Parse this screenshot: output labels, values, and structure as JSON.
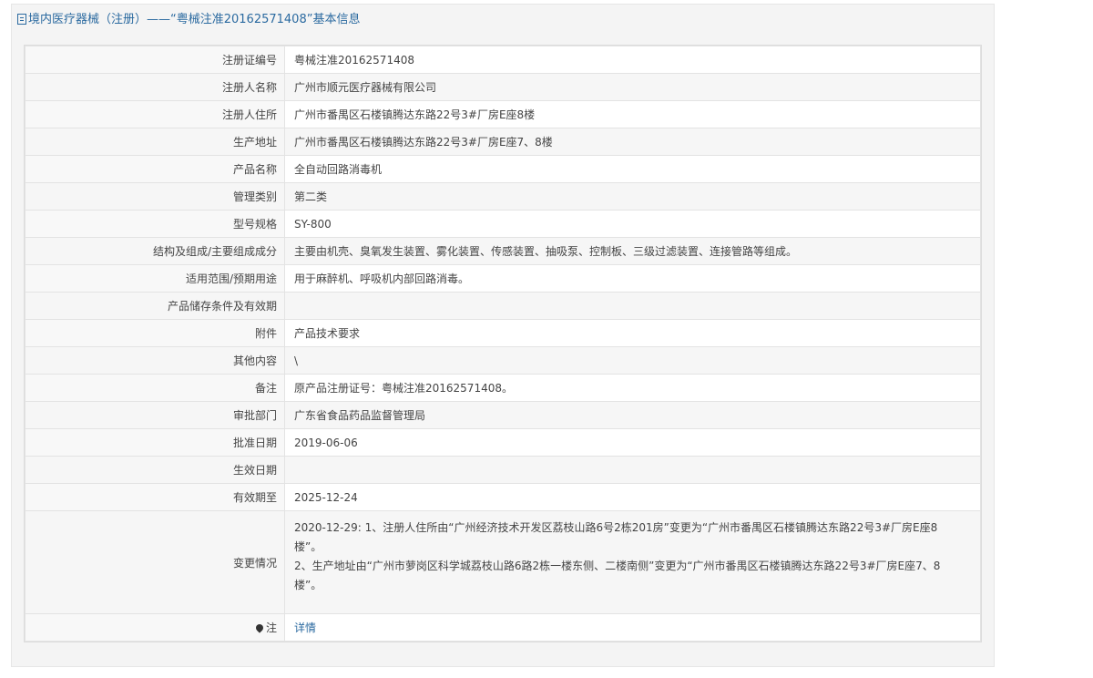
{
  "header": {
    "title": "境内医疗器械（注册）——“粤械注准20162571408”基本信息"
  },
  "rows": [
    {
      "label": "注册证编号",
      "value": "粤械注准20162571408"
    },
    {
      "label": "注册人名称",
      "value": "广州市顺元医疗器械有限公司"
    },
    {
      "label": "注册人住所",
      "value": "广州市番禺区石楼镇腾达东路22号3#厂房E座8楼"
    },
    {
      "label": "生产地址",
      "value": "广州市番禺区石楼镇腾达东路22号3#厂房E座7、8楼"
    },
    {
      "label": "产品名称",
      "value": "全自动回路消毒机"
    },
    {
      "label": "管理类别",
      "value": "第二类"
    },
    {
      "label": "型号规格",
      "value": "SY-800"
    },
    {
      "label": "结构及组成/主要组成成分",
      "value": "主要由机壳、臭氧发生装置、雾化装置、传感装置、抽吸泵、控制板、三级过滤装置、连接管路等组成。"
    },
    {
      "label": "适用范围/预期用途",
      "value": "用于麻醉机、呼吸机内部回路消毒。"
    },
    {
      "label": "产品储存条件及有效期",
      "value": ""
    },
    {
      "label": "附件",
      "value": "产品技术要求"
    },
    {
      "label": "其他内容",
      "value": "\\"
    },
    {
      "label": "备注",
      "value": "原产品注册证号：粤械注准20162571408。"
    },
    {
      "label": "审批部门",
      "value": "广东省食品药品监督管理局"
    },
    {
      "label": "批准日期",
      "value": "2019-06-06"
    },
    {
      "label": "生效日期",
      "value": ""
    },
    {
      "label": "有效期至",
      "value": "2025-12-24"
    }
  ],
  "change": {
    "label": "变更情况",
    "line1": "2020-12-29: 1、注册人住所由“广州经济技术开发区荔枝山路6号2栋201房”变更为“广州市番禺区石楼镇腾达东路22号3#厂房E座8楼”。",
    "line2": "2、生产地址由“广州市萝岗区科学城荔枝山路6路2栋一楼东侧、二楼南侧”变更为“广州市番禺区石楼镇腾达东路22号3#厂房E座7、8楼”。"
  },
  "note": {
    "label": "注",
    "icon": "pin-icon",
    "link_text": "详情"
  },
  "colors": {
    "accent": "#2b6aa0",
    "panel_bg": "#f4f4f4"
  }
}
